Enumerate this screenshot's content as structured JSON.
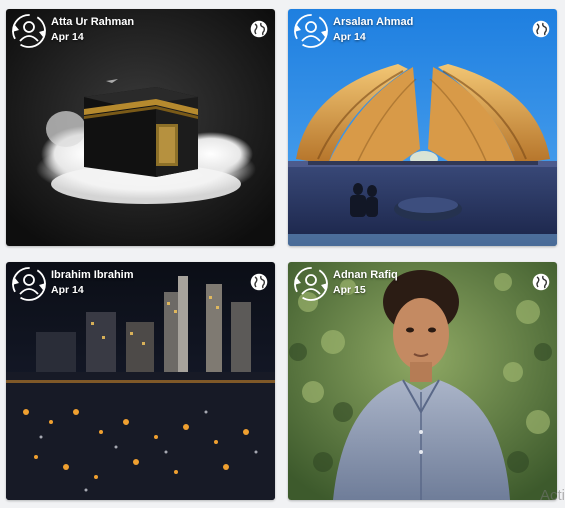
{
  "posts": [
    {
      "author": "Atta Ur Rahman",
      "date": "Apr 14",
      "image": "kaaba-on-clouds-photo",
      "privacy_icon": "globe-icon",
      "avatar_icon": "user-sync-icon"
    },
    {
      "author": "Arsalan Ahmad",
      "date": "Apr 14",
      "image": "pakistan-monument-photo",
      "privacy_icon": "globe-icon",
      "avatar_icon": "user-sync-icon"
    },
    {
      "author": "Ibrahim Ibrahim",
      "date": "Apr 14",
      "image": "night-city-skyline-photo",
      "privacy_icon": "globe-icon",
      "avatar_icon": "user-sync-icon"
    },
    {
      "author": "Adnan Rafiq",
      "date": "Apr 15",
      "image": "boy-portrait-photo",
      "privacy_icon": "globe-icon",
      "avatar_icon": "user-sync-icon"
    }
  ],
  "watermark": "Acti",
  "colors": {
    "page_bg": "#f1f2f4",
    "text_on_photo": "#ffffff"
  }
}
